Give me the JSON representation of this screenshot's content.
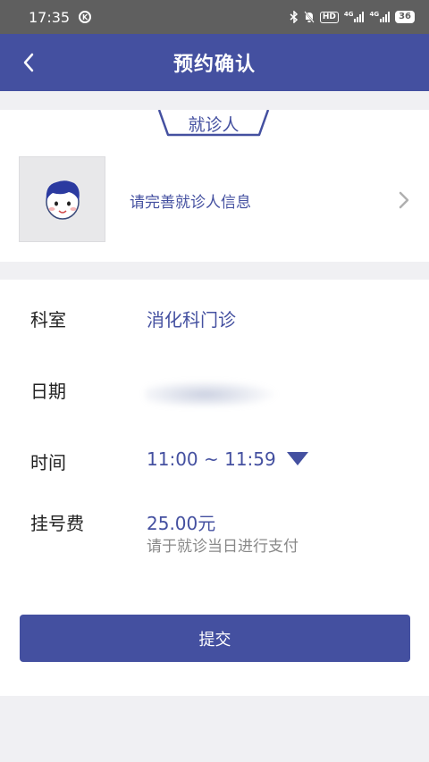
{
  "status_bar": {
    "time": "17:35",
    "k_icon": "K",
    "hd": "HD",
    "signal1": "4G",
    "signal2": "4G",
    "battery": "36"
  },
  "header": {
    "title": "预约确认"
  },
  "patient": {
    "tab_label": "就诊人",
    "hint": "请完善就诊人信息"
  },
  "details": {
    "department_label": "科室",
    "department_value": "消化科门诊",
    "date_label": "日期",
    "time_label": "时间",
    "time_value": "11:00 ~ 11:59",
    "fee_label": "挂号费",
    "fee_value": "25.00元",
    "fee_note": "请于就诊当日进行支付"
  },
  "actions": {
    "submit_label": "提交"
  },
  "colors": {
    "primary": "#4450a0",
    "status_bar": "#5f5f5f",
    "background": "#f0f0f3"
  }
}
